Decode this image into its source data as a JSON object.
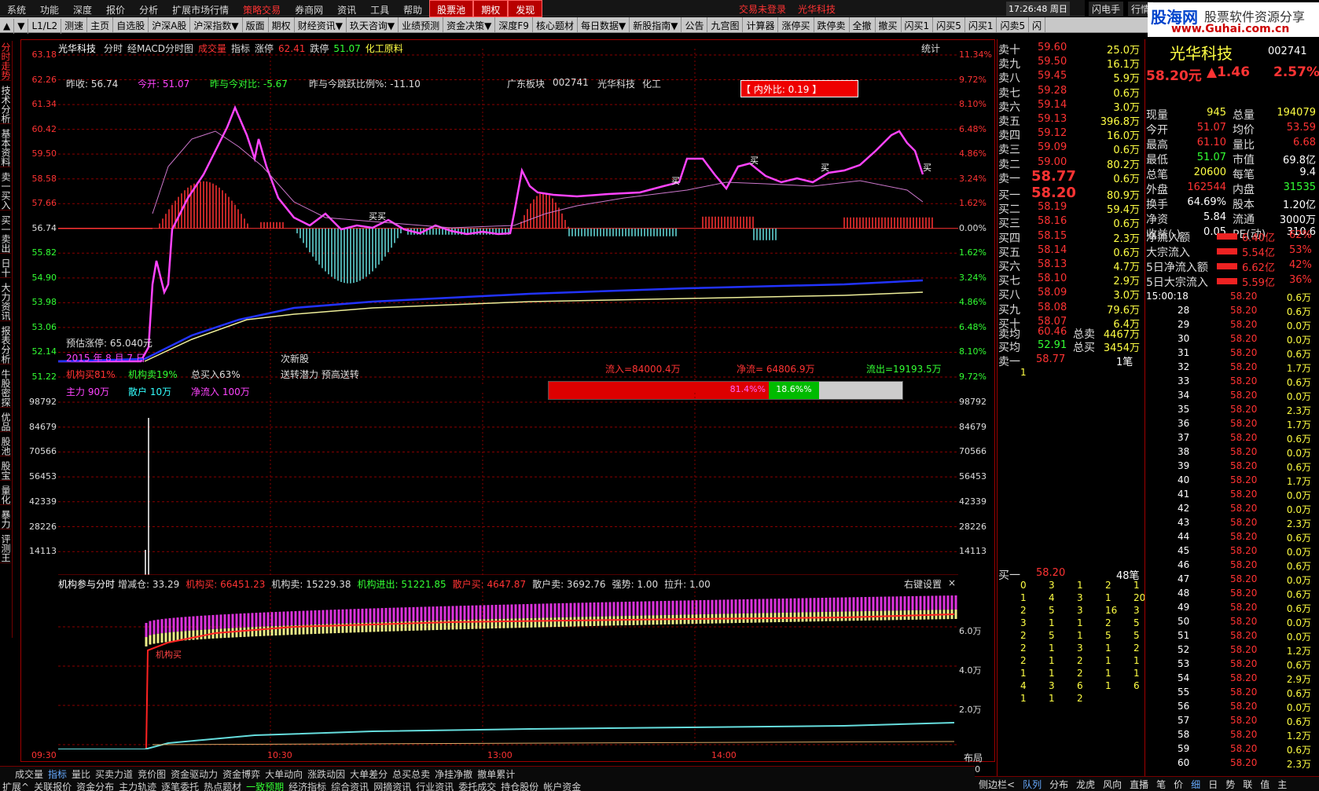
{
  "menu": [
    "系统",
    "功能",
    "深度",
    "报价",
    "分析",
    "扩展市场行情",
    "策略交易",
    "券商网",
    "资讯",
    "工具",
    "帮助",
    "股票池",
    "期权",
    "发现"
  ],
  "menu_status": {
    "login": "交易未登录",
    "stock": "光华科技",
    "time": "17:26:48",
    "weekday": "周日",
    "app": "闪电手",
    "app2": "行情"
  },
  "logo": {
    "brand": "股海网",
    "slogan": "股票软件资源分享",
    "url": "www.Guhai.com.cn"
  },
  "toolbar": [
    "▲",
    "▼",
    "L1/L2",
    "测速",
    "主页",
    "自选股",
    "沪深A股",
    "沪深指数▼",
    "版面",
    "期权",
    "财经资讯▼",
    "玖天咨询▼",
    "业绩预测",
    "资金决策▼",
    "深度F9",
    "核心题材",
    "每日数据▼",
    "新股指南▼",
    "公告",
    "九宫图",
    "计算器",
    "涨停买",
    "跌停卖",
    "全撤",
    "撤买",
    "闪买1",
    "闪买5",
    "闪买1",
    "闪卖5",
    "闪"
  ],
  "side_tabs": [
    "分时走势",
    "技术分析",
    "基本资料",
    "卖一买入",
    "买一卖出",
    "日十",
    "大力资讯",
    "报表分析",
    "牛股密探",
    "优品",
    "股池",
    "股宝",
    "量化",
    "暴力",
    "评测王"
  ],
  "chart_header": {
    "name": "光华科技",
    "items": [
      "分时",
      "经MACD分时图",
      "成交量",
      "指标",
      "涨停",
      "62.41",
      "跌停",
      "51.07",
      "化工原料"
    ],
    "stat": "统计"
  },
  "info_line": {
    "prev_close": "昨收: 56.74",
    "open": "今开: 51.07",
    "vs_prev": "昨与今对比: -5.67",
    "jump": "昨与今跳跃比例%: -11.10",
    "sector": "广东板块",
    "code": "002741",
    "name": "光华科技",
    "industry": "化工"
  },
  "neiwai": "【 内外比: 0.19 】",
  "overlay": {
    "target": "预估涨停: 65.040元",
    "date": "2015 年 8 月 7 日",
    "inst_buy": "机构买81%",
    "inst_sell": "机构卖19%",
    "total_buy": "总买入63%",
    "new_stock": "次新股",
    "potential": "送转潜力 预高送转",
    "main": "主力 90万",
    "retail": "散户 10万",
    "net": "净流入 100万",
    "inflow": "流入=84000.4万",
    "net_flow": "净流= 64806.9万",
    "outflow": "流出=19193.5万",
    "bar_red": "81.4%%",
    "bar_green": "18.6%%"
  },
  "price_ticks_left": [
    "63.18",
    "62.26",
    "61.34",
    "60.42",
    "59.50",
    "58.58",
    "57.66",
    "56.74",
    "55.82",
    "54.90",
    "53.98",
    "53.06",
    "52.14",
    "51.22"
  ],
  "price_ticks_right": [
    "11.34%",
    "9.72%",
    "8.10%",
    "6.48%",
    "4.86%",
    "3.24%",
    "1.62%",
    "0.00%",
    "1.62%",
    "3.24%",
    "4.86%",
    "6.48%",
    "8.10%",
    "9.72%"
  ],
  "vol_ticks": [
    "98792",
    "84679",
    "70566",
    "56453",
    "42339",
    "28226",
    "14113"
  ],
  "buy_marks": [
    "买",
    "买买",
    "买",
    "买",
    "买"
  ],
  "lower_header": {
    "title": "机构参与分时",
    "items": [
      "增减仓: 33.29",
      "机构买: 66451.23",
      "机构卖: 15229.38",
      "机构进出: 51221.85",
      "散户买: 4647.87",
      "散户卖: 3692.76",
      "强势: 1.00",
      "拉升: 1.00"
    ],
    "setting": "右键设置",
    "close": "×"
  },
  "lower_ticks": [
    "6.0万",
    "4.0万",
    "2.0万"
  ],
  "lower_mark": "机构买",
  "time_axis": [
    "09:30",
    "10:30",
    "13:00",
    "14:00"
  ],
  "layout_label": "布局",
  "bottom_tabs": [
    "成交量",
    "指标",
    "量比",
    "买卖力道",
    "竞价图",
    "资金驱动力",
    "资金博弈",
    "大单动向",
    "涨跌动因",
    "大单差分",
    "总买总卖",
    "净挂净撤",
    "撤单累计"
  ],
  "bottom_tabs2": [
    "扩展^",
    "关联报价",
    "资金分布",
    "主力轨迹",
    "逐笔委托",
    "热点题材",
    "一致预期",
    "经济指标",
    "综合资讯",
    "网摘资讯",
    "行业资讯",
    "委托成交",
    "持仓股份",
    "帐户资金"
  ],
  "right_bottom_tabs": [
    "侧边栏<",
    "队列",
    "分布",
    "龙虎",
    "风向",
    "直播",
    "笔",
    "价",
    "细",
    "日",
    "势",
    "联",
    "值",
    "主"
  ],
  "order_book": {
    "sell": [
      [
        "卖十",
        "59.60",
        "25.0万"
      ],
      [
        "卖九",
        "59.50",
        "16.1万"
      ],
      [
        "卖八",
        "59.45",
        "5.9万"
      ],
      [
        "卖七",
        "59.28",
        "0.6万"
      ],
      [
        "卖六",
        "59.14",
        "3.0万"
      ],
      [
        "卖五",
        "59.13",
        "396.8万"
      ],
      [
        "卖四",
        "59.12",
        "16.0万"
      ],
      [
        "卖三",
        "59.09",
        "0.6万"
      ],
      [
        "卖二",
        "59.00",
        "80.2万"
      ],
      [
        "卖一",
        "58.77",
        "0.6万"
      ]
    ],
    "buy": [
      [
        "买一",
        "58.20",
        "80.9万"
      ],
      [
        "买二",
        "58.19",
        "59.4万"
      ],
      [
        "买三",
        "58.16",
        "0.6万"
      ],
      [
        "买四",
        "58.15",
        "2.3万"
      ],
      [
        "买五",
        "58.14",
        "0.6万"
      ],
      [
        "买六",
        "58.13",
        "4.7万"
      ],
      [
        "买七",
        "58.10",
        "2.9万"
      ],
      [
        "买八",
        "58.09",
        "3.0万"
      ],
      [
        "买九",
        "58.08",
        "79.6万"
      ],
      [
        "买十",
        "58.07",
        "6.4万"
      ]
    ],
    "avg": [
      [
        "卖均",
        "60.46",
        "总卖",
        "4467万"
      ],
      [
        "买均",
        "52.91",
        "总买",
        "3454万"
      ]
    ],
    "sell1_queue": {
      "label": "卖一",
      "price": "58.77",
      "count": "1笔",
      "values": [
        "1"
      ]
    },
    "buy1_queue": {
      "label": "买一",
      "price": "58.20",
      "count": "48笔",
      "rows": [
        [
          "0",
          "3",
          "1",
          "2",
          "1"
        ],
        [
          "1",
          "4",
          "3",
          "1",
          "20"
        ],
        [
          "2",
          "5",
          "3",
          "16",
          "3"
        ],
        [
          "3",
          "1",
          "1",
          "2",
          "5"
        ],
        [
          "2",
          "5",
          "1",
          "5",
          "5"
        ],
        [
          "2",
          "1",
          "3",
          "1",
          "2"
        ],
        [
          "2",
          "1",
          "2",
          "1",
          "1"
        ],
        [
          "1",
          "1",
          "2",
          "1",
          "1"
        ],
        [
          "4",
          "3",
          "6",
          "1",
          "6"
        ],
        [
          "1",
          "1",
          "2",
          "",
          ""
        ]
      ]
    }
  },
  "quote": {
    "name": "光华科技",
    "code": "002741",
    "price": "58.20元",
    "change": "▲1.46",
    "pct": "2.57%",
    "rows": [
      [
        "现量",
        "945",
        "总量",
        "194079"
      ],
      [
        "今开",
        "51.07",
        "均价",
        "53.59"
      ],
      [
        "最高",
        "61.10",
        "量比",
        "6.68"
      ],
      [
        "最低",
        "51.07",
        "市值",
        "69.8亿"
      ],
      [
        "总笔",
        "20600",
        "每笔",
        "9.4"
      ],
      [
        "外盘",
        "162544",
        "内盘",
        "31535"
      ],
      [
        "换手",
        "64.69%",
        "股本",
        "1.20亿"
      ],
      [
        "净资",
        "5.84",
        "流通",
        "3000万"
      ],
      [
        "收益(-)",
        "0.05",
        "PE(动)",
        "310.6"
      ]
    ],
    "flows": [
      [
        "净流入额",
        "6.40亿",
        "62%"
      ],
      [
        "大宗流入",
        "5.54亿",
        "53%"
      ],
      [
        "5日净流入额",
        "6.62亿",
        "42%"
      ],
      [
        "5日大宗流入",
        "5.59亿",
        "36%"
      ]
    ]
  },
  "ticks": {
    "first_time": "15:00:18",
    "rows": [
      [
        "15:00:18",
        "58.20",
        "0.6万"
      ],
      [
        "28",
        "58.20",
        "0.6万"
      ],
      [
        "29",
        "58.20",
        "0.0万"
      ],
      [
        "30",
        "58.20",
        "0.0万"
      ],
      [
        "31",
        "58.20",
        "0.6万"
      ],
      [
        "32",
        "58.20",
        "1.7万"
      ],
      [
        "33",
        "58.20",
        "0.6万"
      ],
      [
        "34",
        "58.20",
        "0.0万"
      ],
      [
        "35",
        "58.20",
        "2.3万"
      ],
      [
        "36",
        "58.20",
        "1.7万"
      ],
      [
        "37",
        "58.20",
        "0.6万"
      ],
      [
        "38",
        "58.20",
        "0.0万"
      ],
      [
        "39",
        "58.20",
        "0.6万"
      ],
      [
        "40",
        "58.20",
        "1.7万"
      ],
      [
        "41",
        "58.20",
        "0.0万"
      ],
      [
        "42",
        "58.20",
        "0.0万"
      ],
      [
        "43",
        "58.20",
        "2.3万"
      ],
      [
        "44",
        "58.20",
        "0.6万"
      ],
      [
        "45",
        "58.20",
        "0.0万"
      ],
      [
        "46",
        "58.20",
        "0.6万"
      ],
      [
        "47",
        "58.20",
        "0.0万"
      ],
      [
        "48",
        "58.20",
        "0.6万"
      ],
      [
        "49",
        "58.20",
        "0.6万"
      ],
      [
        "50",
        "58.20",
        "0.0万"
      ],
      [
        "51",
        "58.20",
        "0.0万"
      ],
      [
        "52",
        "58.20",
        "1.2万"
      ],
      [
        "53",
        "58.20",
        "0.6万"
      ],
      [
        "54",
        "58.20",
        "2.9万"
      ],
      [
        "55",
        "58.20",
        "0.6万"
      ],
      [
        "56",
        "58.20",
        "0.0万"
      ],
      [
        "57",
        "58.20",
        "0.6万"
      ],
      [
        "58",
        "58.20",
        "1.2万"
      ],
      [
        "59",
        "58.20",
        "0.6万"
      ],
      [
        "60",
        "58.20",
        "2.3万"
      ]
    ]
  },
  "colors": {
    "up": "#ff3333",
    "down": "#33ff33",
    "price_line": "#ff44ff",
    "avg_line": "#ffff44",
    "grid": "#a00000",
    "bg": "#000000",
    "macd_up": "#ff3333",
    "macd_down": "#66dddd"
  }
}
